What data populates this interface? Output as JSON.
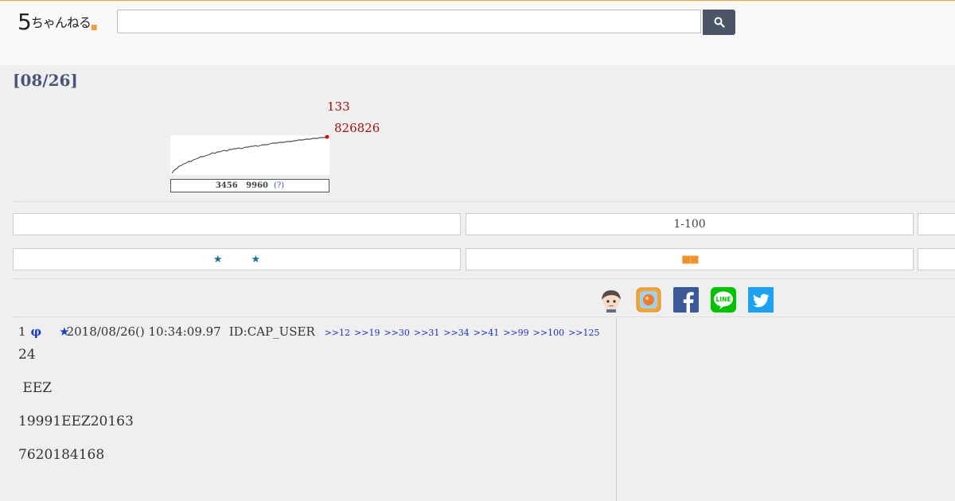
{
  "logo": {
    "main": "5",
    "sub": "ちゃんねる",
    "mark": "■"
  },
  "search": {
    "placeholder": "",
    "button_icon": "search-icon"
  },
  "title": "[08/26]",
  "stats": {
    "count_top": "133",
    "count_bottom": "826826",
    "caption_a": "3456",
    "caption_b": "9960",
    "caption_help": "(?)"
  },
  "nav": {
    "range_label": "1-100",
    "star_a": "★",
    "star_b": "★",
    "squares": "■■"
  },
  "share_icons": [
    "mascot-icon",
    "app-icon",
    "facebook-icon",
    "line-icon",
    "twitter-icon"
  ],
  "post": {
    "number": "1",
    "name": "φ",
    "star": "★",
    "date": "2018/08/26() 10:34:09.97",
    "id": "ID:CAP_USER",
    "refs": [
      ">>12",
      ">>19",
      ">>30",
      ">>31",
      ">>34",
      ">>41",
      ">>99",
      ">>100",
      ">>125"
    ],
    "lines": [
      "24",
      " EEZ",
      "19991EEZ20163",
      "7620184168"
    ]
  },
  "colors": {
    "accent": "#f0a040",
    "search_button": "#4a5568",
    "title": "#4a5578",
    "stat_red": "#a01010",
    "link_blue": "#1a30c0"
  }
}
